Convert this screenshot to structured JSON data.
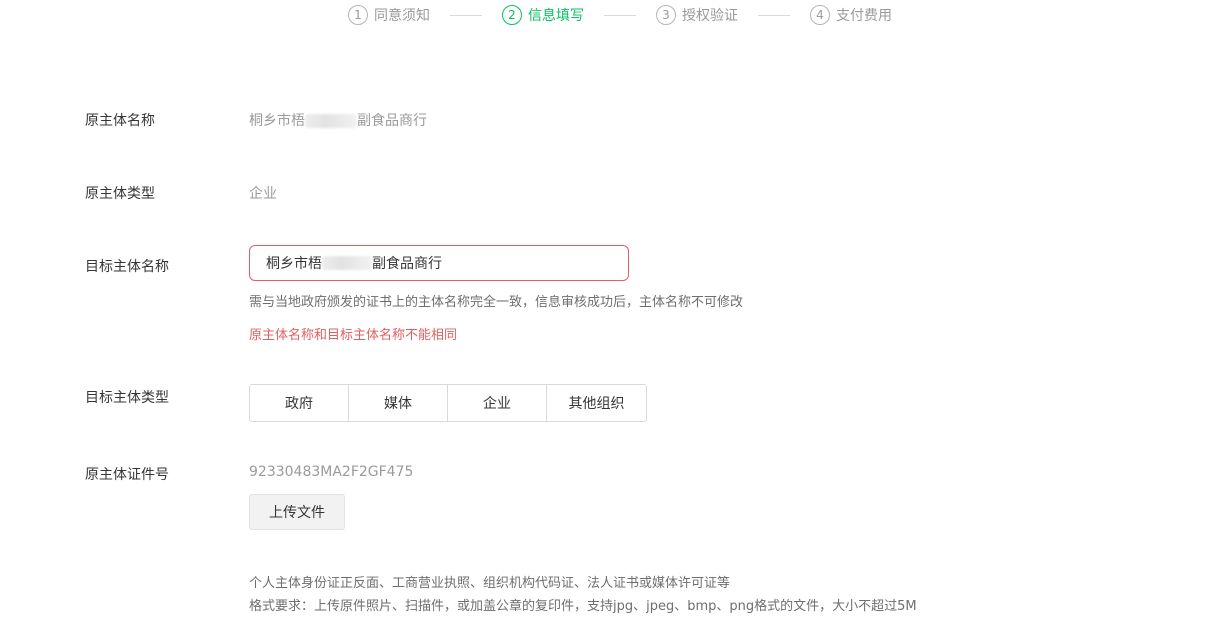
{
  "steps": [
    {
      "num": "1",
      "label": "同意须知",
      "active": false
    },
    {
      "num": "2",
      "label": "信息填写",
      "active": true
    },
    {
      "num": "3",
      "label": "授权验证",
      "active": false
    },
    {
      "num": "4",
      "label": "支付费用",
      "active": false
    }
  ],
  "form": {
    "orig_name_label": "原主体名称",
    "orig_name_value_prefix": "桐乡市梧",
    "orig_name_value_suffix": "副食品商行",
    "orig_type_label": "原主体类型",
    "orig_type_value": "企业",
    "target_name_label": "目标主体名称",
    "target_name_value_prefix": "桐乡市梧",
    "target_name_value_suffix": "副食品商行",
    "target_name_hint": "需与当地政府颁发的证书上的主体名称完全一致，信息审核成功后，主体名称不可修改",
    "target_name_error": "原主体名称和目标主体名称不能相同",
    "target_type_label": "目标主体类型",
    "target_type_options": [
      "政府",
      "媒体",
      "企业",
      "其他组织"
    ],
    "cert_label": "原主体证件号",
    "cert_value": "92330483MA2F2GF475",
    "upload_button": "上传文件",
    "upload_hint_1": "个人主体身份证正反面、工商营业执照、组织机构代码证、法人证书或媒体许可证等",
    "upload_hint_2": "格式要求：上传原件照片、扫描件，或加盖公章的复印件，支持jpg、jpeg、bmp、png格式的文件，大小不超过5M"
  },
  "colors": {
    "active": "#07c160",
    "error": "#e15f5f"
  }
}
